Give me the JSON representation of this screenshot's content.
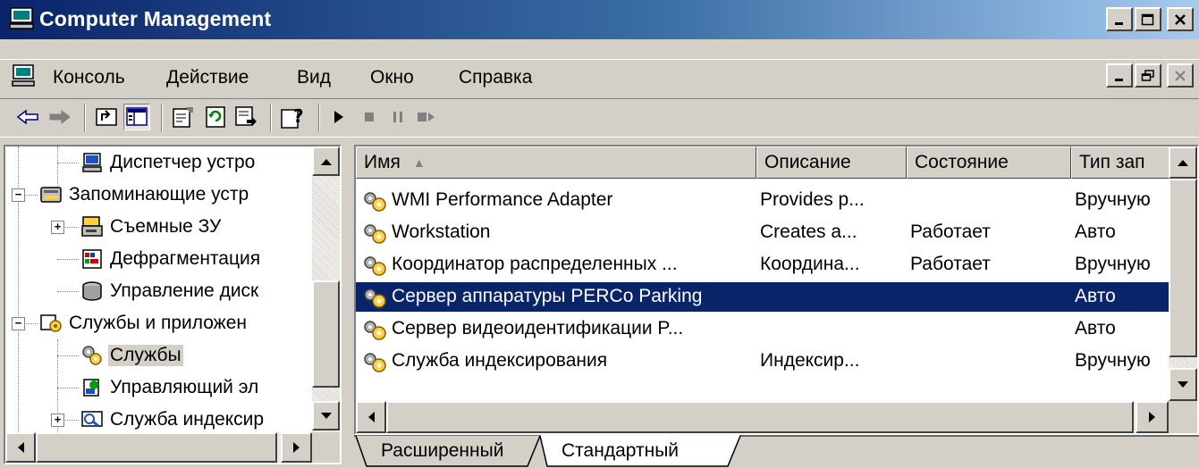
{
  "window": {
    "title": "Computer Management",
    "icon": "computer-icon",
    "caption_buttons": [
      "minimize-icon",
      "maximize-icon",
      "close-icon"
    ]
  },
  "menu": {
    "icon": "console-icon",
    "items": [
      {
        "label": "Консоль"
      },
      {
        "label": "Действие"
      },
      {
        "label": "Вид"
      },
      {
        "label": "Окно"
      },
      {
        "label": "Справка"
      }
    ],
    "mdi_buttons": [
      "mdi-minimize-icon",
      "mdi-restore-icon",
      "mdi-close-icon"
    ]
  },
  "toolbar": {
    "buttons": [
      "back-arrow-icon",
      "forward-arrow-icon",
      "up-level-icon",
      "show-hide-tree-icon",
      "properties-icon",
      "refresh-icon",
      "export-list-icon",
      "help-icon",
      "start-service-icon",
      "stop-service-icon",
      "pause-service-icon",
      "restart-service-icon"
    ],
    "pressed": "show-hide-tree-icon"
  },
  "tree": {
    "items": [
      {
        "label": "Диспетчер устро",
        "icon": "device-manager-icon",
        "expander": ""
      },
      {
        "label": "Запоминающие устр",
        "icon": "storage-icon",
        "expander": "−"
      },
      {
        "label": "Съемные ЗУ",
        "icon": "removable-storage-icon",
        "expander": "+"
      },
      {
        "label": "Дефрагментация",
        "icon": "defragmenter-icon",
        "expander": ""
      },
      {
        "label": "Управление диск",
        "icon": "disk-management-icon",
        "expander": ""
      },
      {
        "label": "Службы и приложен",
        "icon": "services-applications-icon",
        "expander": "−"
      },
      {
        "label": "Службы",
        "icon": "services-icon",
        "expander": "",
        "selected": true
      },
      {
        "label": "Управляющий эл",
        "icon": "wmi-control-icon",
        "expander": ""
      },
      {
        "label": "Служба индексир",
        "icon": "indexing-service-icon",
        "expander": "+"
      }
    ]
  },
  "list": {
    "columns": [
      {
        "label": "Имя",
        "sort_indicator": "▲"
      },
      {
        "label": "Описание"
      },
      {
        "label": "Состояние"
      },
      {
        "label": "Тип зап"
      }
    ],
    "rows": [
      {
        "name": "WMI Performance Adapter",
        "description": "Provides p...",
        "status": "",
        "startup": "Вручную"
      },
      {
        "name": "Workstation",
        "description": "Creates a...",
        "status": "Работает",
        "startup": "Авто"
      },
      {
        "name": "Координатор распределенных ...",
        "description": "Координа...",
        "status": "Работает",
        "startup": "Вручную"
      },
      {
        "name": "Сервер аппаратуры PERCo Parking",
        "description": "",
        "status": "",
        "startup": "Авто",
        "selected": true
      },
      {
        "name": "Сервер видеоидентификации P...",
        "description": "",
        "status": "",
        "startup": "Авто"
      },
      {
        "name": "Служба индексирования",
        "description": "Индексир...",
        "status": "",
        "startup": "Вручную"
      }
    ],
    "row_icon": "service-gear-icon"
  },
  "tabs": [
    {
      "label": "Расширенный",
      "active": false
    },
    {
      "label": "Стандартный",
      "active": true
    }
  ],
  "colors": {
    "title_gradient_start": "#0a246a",
    "title_gradient_end": "#a6caf0",
    "selection": "#0a246a",
    "face": "#d4d0c8"
  }
}
